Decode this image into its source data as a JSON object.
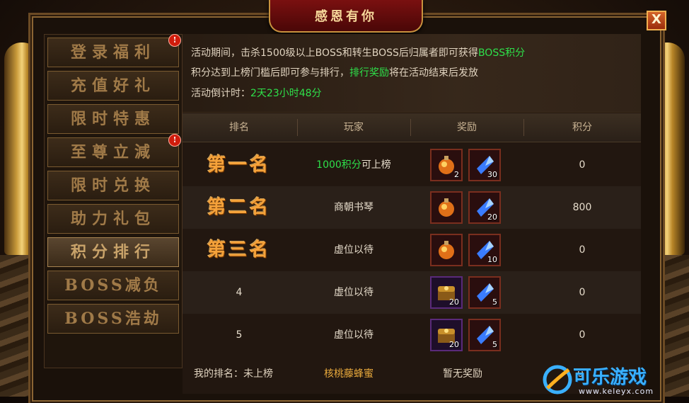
{
  "title": "感恩有你",
  "close_label": "X",
  "menu": [
    {
      "label": "登录福利",
      "badge": "!"
    },
    {
      "label": "充值好礼",
      "badge": ""
    },
    {
      "label": "限时特惠",
      "badge": ""
    },
    {
      "label": "至尊立減",
      "badge": "!"
    },
    {
      "label": "限时兑换",
      "badge": ""
    },
    {
      "label": "助力礼包",
      "badge": ""
    },
    {
      "label": "积分排行",
      "badge": "",
      "active": true
    },
    {
      "label": "BOSS减负",
      "badge": ""
    },
    {
      "label": "BOSS浩劫",
      "badge": ""
    }
  ],
  "info": {
    "line1_prefix": "活动期间，击杀1500级以上BOSS和转生BOSS后归属者即可获得",
    "line1_highlight": "BOSS积分",
    "line2_prefix": "积分达到上榜门槛后即可参与排行，",
    "line2_highlight": "排行奖励",
    "line2_suffix": "将在活动结束后发放",
    "line3_prefix": "活动倒计时：",
    "line3_highlight": "2天23小时48分"
  },
  "table": {
    "headers": [
      "排名",
      "玩家",
      "奖励",
      "积分"
    ],
    "rows": [
      {
        "rank": "第一名",
        "player_highlight": "1000积分",
        "player": "可上榜",
        "reward1_count": "2",
        "reward2_count": "30",
        "score": "0",
        "reward1_type": "potion-icon",
        "reward2_type": "crystal-icon"
      },
      {
        "rank": "第二名",
        "player_highlight": "",
        "player": "商朝书琴",
        "reward1_count": "",
        "reward2_count": "20",
        "score": "800",
        "reward1_type": "potion-icon",
        "reward2_type": "crystal-icon"
      },
      {
        "rank": "第三名",
        "player_highlight": "",
        "player": "虚位以待",
        "reward1_count": "",
        "reward2_count": "10",
        "score": "0",
        "reward1_type": "potion-icon",
        "reward2_type": "crystal-icon"
      },
      {
        "rank": "4",
        "player_highlight": "",
        "player": "虚位以待",
        "reward1_count": "20",
        "reward2_count": "5",
        "score": "0",
        "reward1_type": "treasure-chest-icon",
        "reward2_type": "crystal-icon"
      },
      {
        "rank": "5",
        "player_highlight": "",
        "player": "虚位以待",
        "reward1_count": "20",
        "reward2_count": "5",
        "score": "0",
        "reward1_type": "treasure-chest-icon",
        "reward2_type": "crystal-icon"
      }
    ]
  },
  "footer": {
    "my_rank_label": "我的排名：",
    "my_rank_value": "未上榜",
    "player_name": "核桃藤蜂蜜",
    "reward_text": "暂无奖励",
    "score": "0"
  },
  "watermark": {
    "text": "可乐游戏",
    "url": "www.keleyx.com"
  },
  "colors": {
    "highlight_green": "#2ee04a",
    "rank_gold": "#f5a23a",
    "frame_gold": "#c8923e"
  }
}
